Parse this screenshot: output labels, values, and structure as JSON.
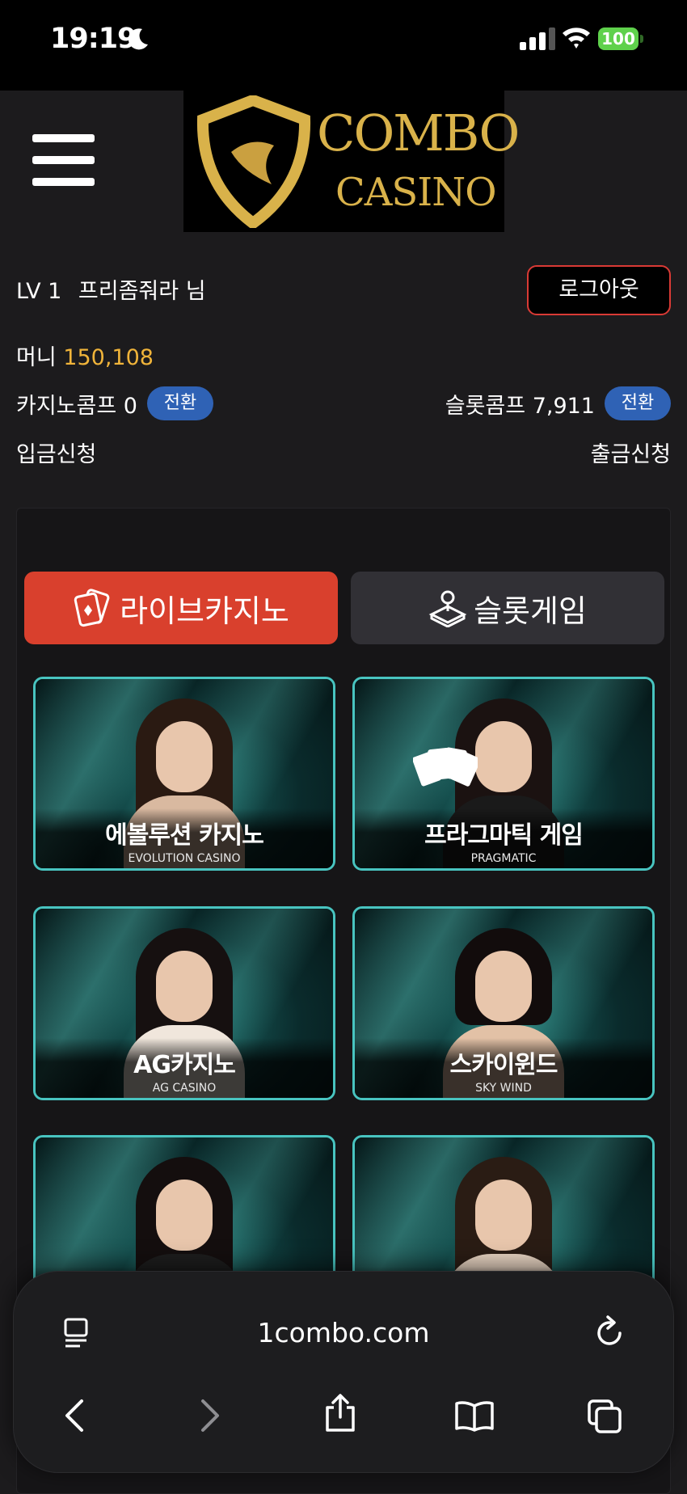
{
  "status_bar": {
    "time": "19:19",
    "battery": "100"
  },
  "header": {
    "logo_line1": "COMBO",
    "logo_line2": "CASINO"
  },
  "user": {
    "level": "LV 1",
    "name": "프리좀줘라 님",
    "logout_label": "로그아웃"
  },
  "wallet": {
    "money_label": "머니",
    "money_value": "150,108",
    "casino_comp_label": "카지노콤프 0",
    "slot_comp_label": "슬롯콤프 7,911",
    "convert_label": "전환",
    "deposit_label": "입금신청",
    "withdraw_label": "출금신청"
  },
  "tabs": [
    {
      "label": "라이브카지노",
      "active": true
    },
    {
      "label": "슬롯게임",
      "active": false
    }
  ],
  "games": [
    {
      "title_kor": "에볼루션 카지노",
      "title_eng": "EVOLUTION CASINO"
    },
    {
      "title_kor": "프라그마틱 게임",
      "title_eng": "PRAGMATIC"
    },
    {
      "title_kor": "AG카지노",
      "title_eng": "AG CASINO"
    },
    {
      "title_kor": "스카이윈드",
      "title_eng": "SKY WIND"
    },
    {
      "title_kor": "",
      "title_eng": ""
    },
    {
      "title_kor": "",
      "title_eng": ""
    }
  ],
  "browser": {
    "url": "1combo.com"
  },
  "colors": {
    "accent_red": "#d9402d",
    "gold": "#f0b43a",
    "blue_pill": "#2f62b5",
    "card_border": "#48c4c0"
  }
}
